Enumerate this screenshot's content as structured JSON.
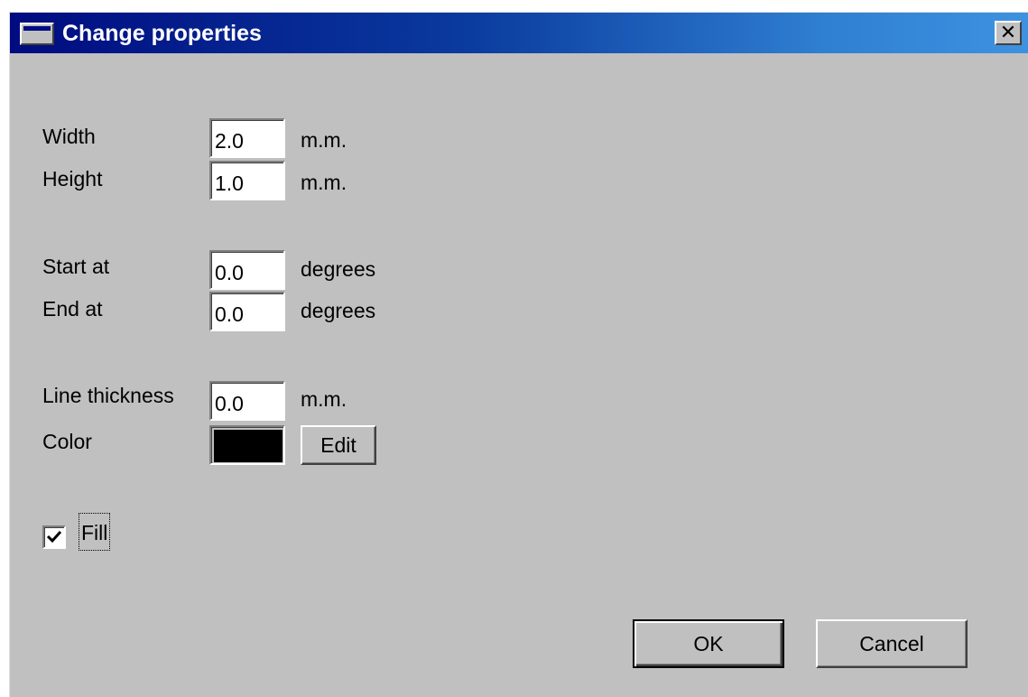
{
  "window": {
    "title": "Change properties",
    "close_glyph": "✕"
  },
  "size": {
    "width_label": "Width",
    "width_value": "2.0",
    "width_unit": "m.m.",
    "height_label": "Height",
    "height_value": "1.0",
    "height_unit": "m.m."
  },
  "angles": {
    "start_label": "Start at",
    "start_value": "0.0",
    "start_unit": "degrees",
    "end_label": "End at",
    "end_value": "0.0",
    "end_unit": "degrees"
  },
  "line": {
    "thickness_label": "Line thickness",
    "thickness_value": "0.0",
    "thickness_unit": "m.m.",
    "color_label": "Color",
    "color_value": "#000000",
    "edit_label": "Edit"
  },
  "fill": {
    "label": "Fill",
    "checked": true
  },
  "buttons": {
    "ok_label": "OK",
    "cancel_label": "Cancel"
  },
  "icons": {
    "window_icon": "window-icon",
    "close_icon": "close-icon",
    "check_icon": "checkmark-icon"
  }
}
